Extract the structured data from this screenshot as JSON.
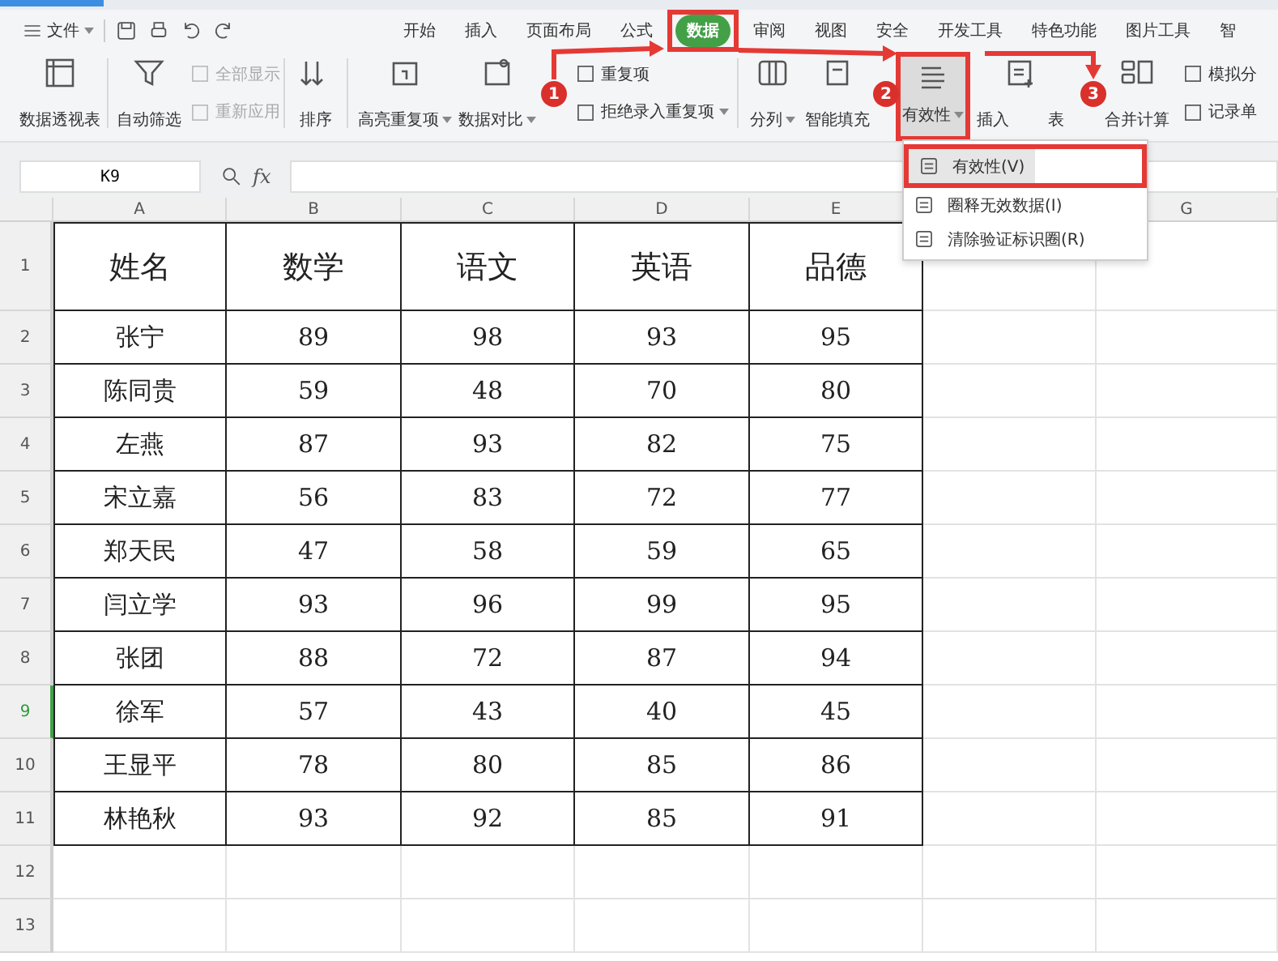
{
  "menu": {
    "file": "文件",
    "tabs": [
      {
        "label": "开始",
        "selected": false
      },
      {
        "label": "插入",
        "selected": false
      },
      {
        "label": "页面布局",
        "selected": false
      },
      {
        "label": "公式",
        "selected": false
      },
      {
        "label": "数据",
        "selected": true
      },
      {
        "label": "审阅",
        "selected": false
      },
      {
        "label": "视图",
        "selected": false
      },
      {
        "label": "安全",
        "selected": false
      },
      {
        "label": "开发工具",
        "selected": false
      },
      {
        "label": "特色功能",
        "selected": false
      },
      {
        "label": "图片工具",
        "selected": false
      },
      {
        "label": "智",
        "selected": false
      }
    ]
  },
  "ribbon": [
    {
      "kind": "large",
      "label": "数据透视表",
      "dropdown": false,
      "pressed": false
    },
    {
      "kind": "separator"
    },
    {
      "kind": "large",
      "label": "自动筛选",
      "dropdown": false,
      "pressed": false
    },
    {
      "kind": "stack",
      "items": [
        {
          "label": "全部显示",
          "disabled": true,
          "dropdown": false
        },
        {
          "label": "重新应用",
          "disabled": true,
          "dropdown": false
        }
      ]
    },
    {
      "kind": "separator"
    },
    {
      "kind": "sort",
      "label": "排序"
    },
    {
      "kind": "separator"
    },
    {
      "kind": "large",
      "label": "高亮重复项",
      "dropdown": true,
      "pressed": false
    },
    {
      "kind": "large",
      "label": "数据对比",
      "dropdown": true,
      "pressed": false
    },
    {
      "kind": "stack",
      "items": [
        {
          "label": "重复项",
          "disabled": false,
          "dropdown": false
        },
        {
          "label": "拒绝录入重复项",
          "disabled": false,
          "dropdown": true
        }
      ]
    },
    {
      "kind": "separator"
    },
    {
      "kind": "large",
      "label": "分列",
      "dropdown": true,
      "pressed": false
    },
    {
      "kind": "large",
      "label": "智能填充",
      "dropdown": false,
      "pressed": false
    },
    {
      "kind": "large",
      "label": "有效性",
      "dropdown": true,
      "pressed": true
    },
    {
      "kind": "large",
      "label": "插入",
      "tail": "表",
      "dropdown": false,
      "pressed": false
    },
    {
      "kind": "large",
      "label": "合并计算",
      "dropdown": false,
      "pressed": false
    },
    {
      "kind": "stack",
      "items": [
        {
          "label": "模拟分",
          "disabled": false,
          "dropdown": false
        },
        {
          "label": "记录单",
          "disabled": false,
          "dropdown": false
        }
      ]
    }
  ],
  "dropdown_menu": [
    {
      "label": "有效性(V)",
      "selected": true
    },
    {
      "label": "圈释无效数据(I)",
      "selected": false
    },
    {
      "label": "清除验证标识圈(R)",
      "selected": false
    }
  ],
  "formula_bar": {
    "cell_ref": "K9",
    "fx": "fx"
  },
  "sheet": {
    "columns": [
      "A",
      "B",
      "C",
      "D",
      "E",
      null,
      "G"
    ],
    "rows": [
      {
        "number": "1",
        "selected": false,
        "cells": [
          "姓名",
          "数学",
          "语文",
          "英语",
          "品德"
        ]
      },
      {
        "number": "2",
        "selected": false,
        "cells": [
          "张宁",
          "89",
          "98",
          "93",
          "95"
        ]
      },
      {
        "number": "3",
        "selected": false,
        "cells": [
          "陈同贵",
          "59",
          "48",
          "70",
          "80"
        ]
      },
      {
        "number": "4",
        "selected": false,
        "cells": [
          "左燕",
          "87",
          "93",
          "82",
          "75"
        ]
      },
      {
        "number": "5",
        "selected": false,
        "cells": [
          "宋立嘉",
          "56",
          "83",
          "72",
          "77"
        ]
      },
      {
        "number": "6",
        "selected": false,
        "cells": [
          "郑天民",
          "47",
          "58",
          "59",
          "65"
        ]
      },
      {
        "number": "7",
        "selected": false,
        "cells": [
          "闫立学",
          "93",
          "96",
          "99",
          "95"
        ]
      },
      {
        "number": "8",
        "selected": false,
        "cells": [
          "张团",
          "88",
          "72",
          "87",
          "94"
        ]
      },
      {
        "number": "9",
        "selected": true,
        "cells": [
          "徐军",
          "57",
          "43",
          "40",
          "45"
        ]
      },
      {
        "number": "10",
        "selected": false,
        "cells": [
          "王显平",
          "78",
          "80",
          "85",
          "86"
        ]
      },
      {
        "number": "11",
        "selected": false,
        "cells": [
          "林艳秋",
          "93",
          "92",
          "85",
          "91"
        ]
      },
      {
        "number": "12",
        "selected": false,
        "cells": []
      },
      {
        "number": "13",
        "selected": false,
        "cells": []
      }
    ]
  },
  "annotations": [
    {
      "label": "1"
    },
    {
      "label": "2"
    },
    {
      "label": "3"
    }
  ]
}
